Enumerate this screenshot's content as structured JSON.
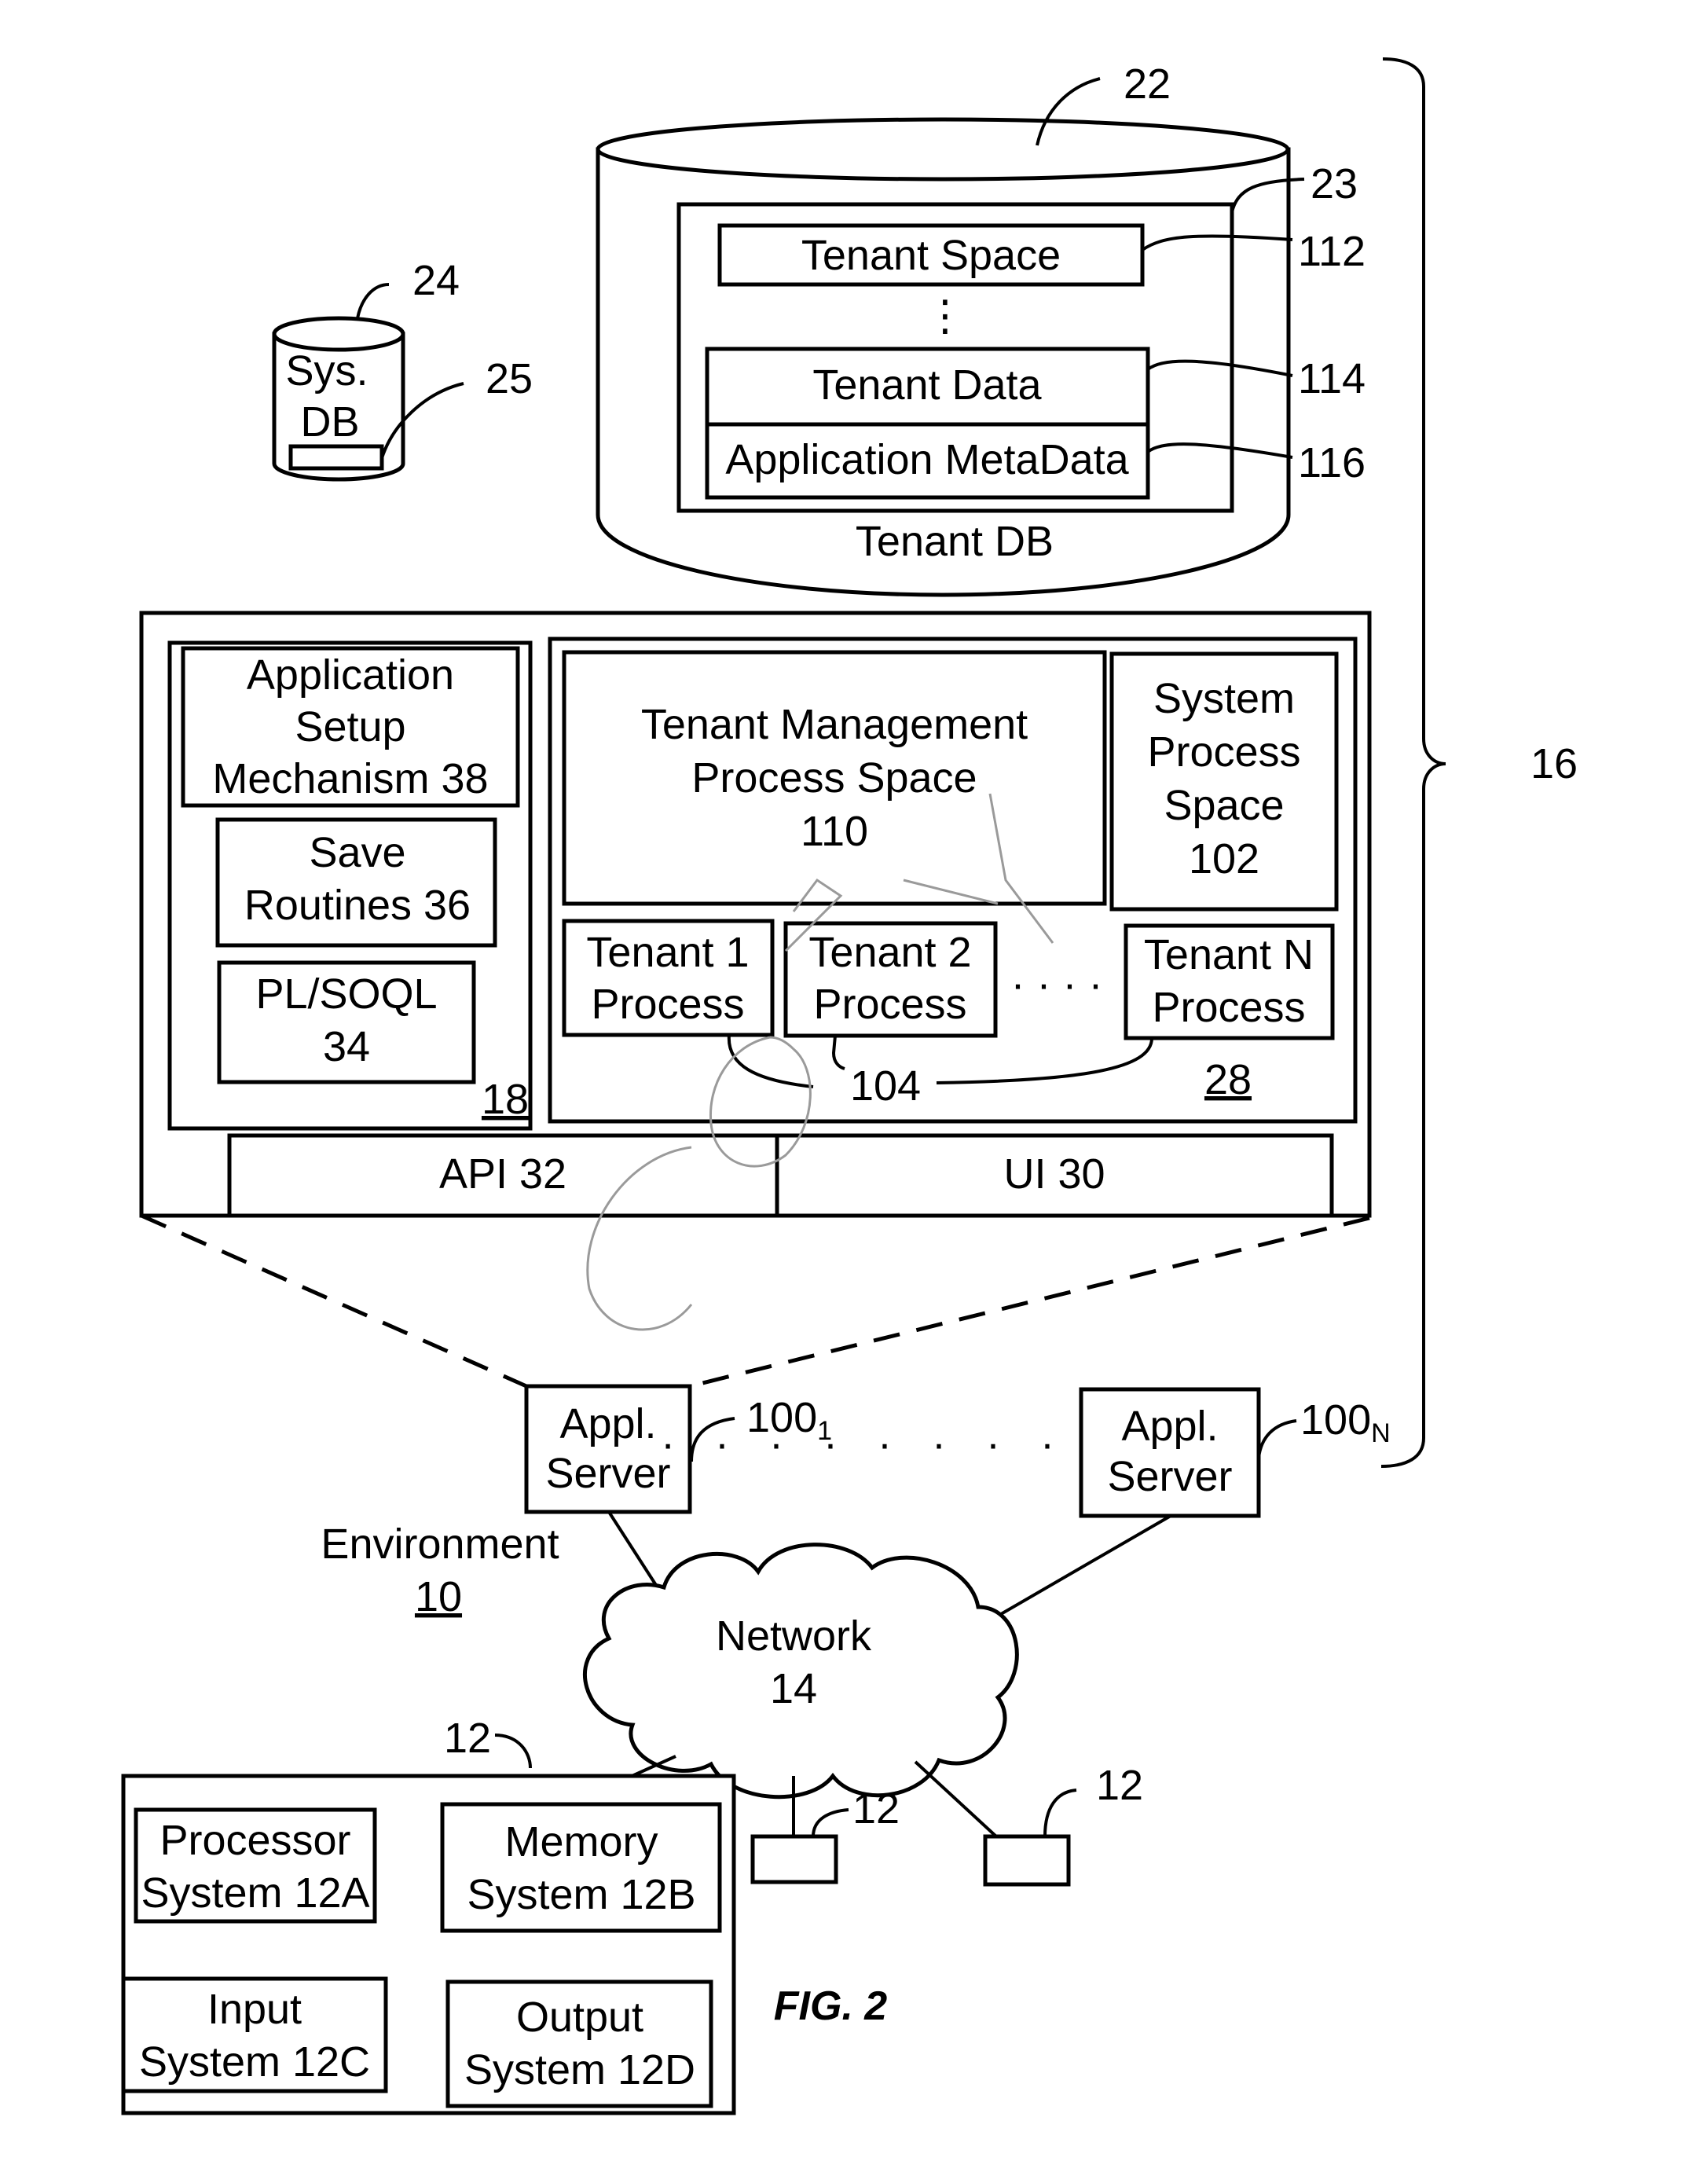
{
  "figure": {
    "caption": "FIG. 2",
    "environment": {
      "label": "Environment",
      "ref": "10"
    },
    "bracket_ref": "16"
  },
  "tenant_db": {
    "ref": "22",
    "label": "Tenant DB",
    "inner_ref": "23",
    "tenant_space": {
      "label": "Tenant Space",
      "ref": "112"
    },
    "ellipsis": "⋮",
    "tenant_data": {
      "label": "Tenant Data",
      "ref": "114"
    },
    "app_metadata": {
      "label": "Application MetaData",
      "ref": "116"
    }
  },
  "sys_db": {
    "ref": "24",
    "line1": "Sys.",
    "line2": "DB",
    "inner_ref": "25"
  },
  "app_platform": {
    "ref": "18",
    "setup": {
      "line1": "Application",
      "line2": "Setup",
      "line3": "Mechanism 38"
    },
    "save": {
      "line1": "Save",
      "line2": "Routines 36"
    },
    "plsoql": {
      "line1": "PL/SOQL",
      "line2": "34"
    }
  },
  "process_space": {
    "ref": "28",
    "tenant_mgmt": {
      "line1": "Tenant Management",
      "line2": "Process Space",
      "line3": "110"
    },
    "system_process": {
      "line1": "System",
      "line2": "Process",
      "line3": "Space",
      "line4": "102"
    },
    "tenant1": {
      "line1": "Tenant 1",
      "line2": "Process"
    },
    "tenant2": {
      "line1": "Tenant 2",
      "line2": "Process"
    },
    "dots": "· · · ·",
    "tenantN": {
      "line1": "Tenant N",
      "line2": "Process"
    },
    "tenant_ref": "104"
  },
  "interfaces": {
    "api": "API 32",
    "ui": "UI 30"
  },
  "app_servers": [
    {
      "line1": "Appl.",
      "line2": "Server",
      "ref": "100",
      "sub": "1"
    },
    {
      "line1": "Appl.",
      "line2": "Server",
      "ref": "100",
      "sub": "N"
    }
  ],
  "network": {
    "line1": "Network",
    "line2": "14"
  },
  "user_system": {
    "ref": "12",
    "processor": {
      "line1": "Processor",
      "line2": "System 12A"
    },
    "memory": {
      "line1": "Memory",
      "line2": "System 12B"
    },
    "input": {
      "line1": "Input",
      "line2": "System 12C"
    },
    "output": {
      "line1": "Output",
      "line2": "System 12D"
    }
  },
  "other_users": [
    {
      "ref": "12"
    },
    {
      "ref": "12"
    }
  ]
}
